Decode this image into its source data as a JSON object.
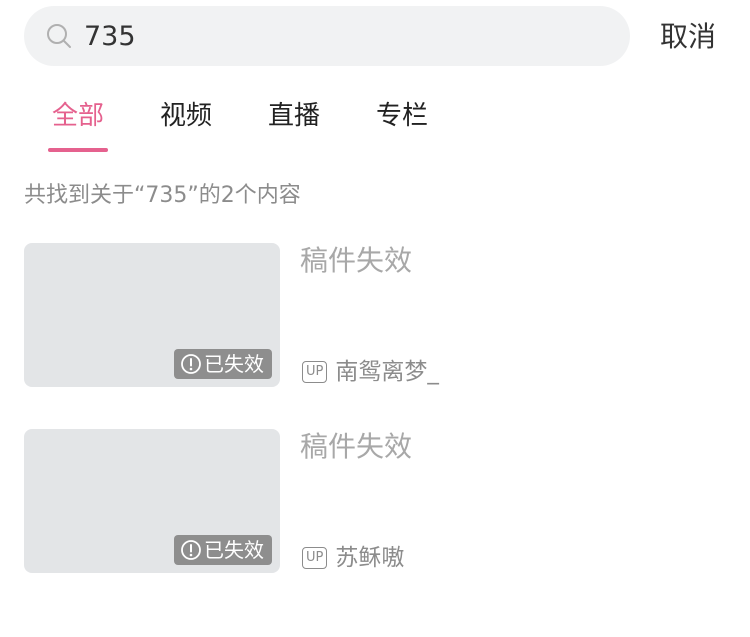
{
  "search": {
    "value": "735",
    "cancel_label": "取消"
  },
  "tabs": [
    {
      "label": "全部",
      "active": true
    },
    {
      "label": "视频",
      "active": false
    },
    {
      "label": "直播",
      "active": false
    },
    {
      "label": "专栏",
      "active": false
    }
  ],
  "summary": "共找到关于“735”的2个内容",
  "results": [
    {
      "title": "稿件失效",
      "badge": "已失效",
      "up_icon": "UP",
      "uploader": "南鸳离梦_"
    },
    {
      "title": "稿件失效",
      "badge": "已失效",
      "up_icon": "UP",
      "uploader": "苏稣嗷"
    }
  ],
  "colors": {
    "accent": "#e5618e",
    "search_bg": "#f1f2f3",
    "thumb_bg": "#e3e5e7",
    "badge_bg": "#8e8e8e"
  },
  "icons": {
    "search": "search-icon",
    "badge": "warning-circle-icon"
  }
}
